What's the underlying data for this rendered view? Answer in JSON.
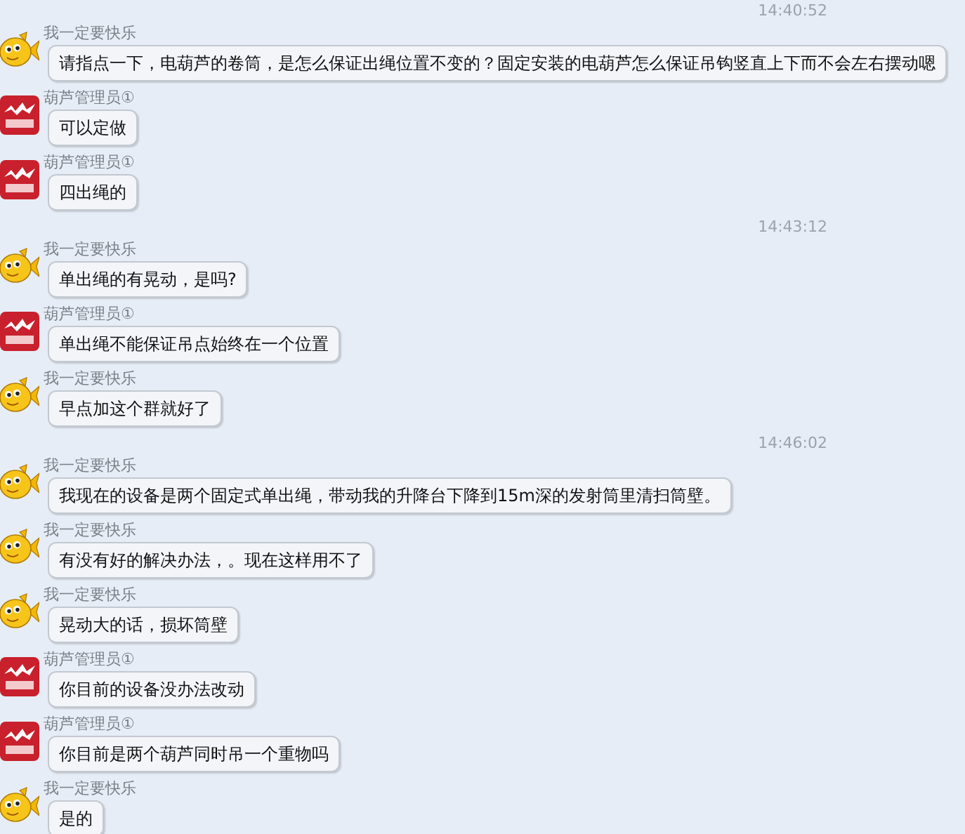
{
  "items": [
    {
      "kind": "time",
      "text": "14:40:52"
    },
    {
      "kind": "message",
      "avatar": {
        "kind": "fish"
      },
      "sender": "我一定要快乐",
      "text": "请指点一下，电葫芦的卷筒，是怎么保证出绳位置不变的？固定安装的电葫芦怎么保证吊钩竖直上下而不会左右摆动嗯"
    },
    {
      "kind": "message",
      "avatar": {
        "kind": "logo"
      },
      "sender": "葫芦管理员①",
      "text": "可以定做"
    },
    {
      "kind": "message",
      "avatar": {
        "kind": "logo"
      },
      "sender": "葫芦管理员①",
      "text": "四出绳的"
    },
    {
      "kind": "time",
      "text": "14:43:12"
    },
    {
      "kind": "message",
      "avatar": {
        "kind": "fish"
      },
      "sender": "我一定要快乐",
      "text": "单出绳的有晃动，是吗?"
    },
    {
      "kind": "message",
      "avatar": {
        "kind": "logo"
      },
      "sender": "葫芦管理员①",
      "text": "单出绳不能保证吊点始终在一个位置"
    },
    {
      "kind": "message",
      "avatar": {
        "kind": "fish"
      },
      "sender": "我一定要快乐",
      "text": "早点加这个群就好了"
    },
    {
      "kind": "time",
      "text": "14:46:02"
    },
    {
      "kind": "message",
      "avatar": {
        "kind": "fish"
      },
      "sender": "我一定要快乐",
      "text": "我现在的设备是两个固定式单出绳，带动我的升降台下降到15m深的发射筒里清扫筒壁。"
    },
    {
      "kind": "message",
      "avatar": {
        "kind": "fish"
      },
      "sender": "我一定要快乐",
      "text": "有没有好的解决办法，。现在这样用不了"
    },
    {
      "kind": "message",
      "avatar": {
        "kind": "fish"
      },
      "sender": "我一定要快乐",
      "text": "晃动大的话，损坏筒壁"
    },
    {
      "kind": "message",
      "avatar": {
        "kind": "logo"
      },
      "sender": "葫芦管理员①",
      "text": "你目前的设备没办法改动"
    },
    {
      "kind": "message",
      "avatar": {
        "kind": "logo"
      },
      "sender": "葫芦管理员①",
      "text": "你目前是两个葫芦同时吊一个重物吗"
    },
    {
      "kind": "message",
      "avatar": {
        "kind": "fish"
      },
      "sender": "我一定要快乐",
      "text": "是的"
    }
  ]
}
